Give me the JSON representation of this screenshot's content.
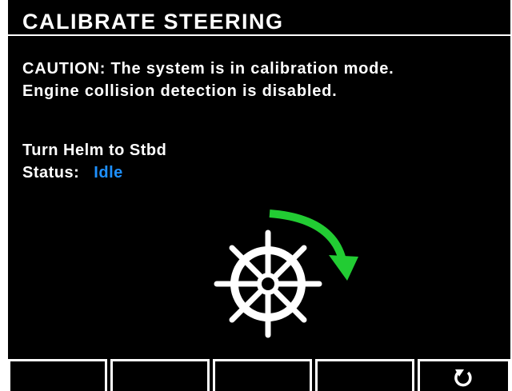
{
  "header": {
    "title": "CALIBRATE STEERING"
  },
  "caution": {
    "line1": "CAUTION: The system is in calibration mode.",
    "line2": "Engine collision detection is disabled."
  },
  "instruction": {
    "text": "Turn Helm to Stbd"
  },
  "status": {
    "label": "Status:",
    "value": "Idle",
    "value_color": "#1e90ff"
  },
  "graphic": {
    "wheel_icon": "ship-helm-wheel-icon",
    "arrow_icon": "turn-starboard-arrow-icon",
    "arrow_color": "#22cc33"
  },
  "softkeys": [
    {
      "label": "",
      "icon": null
    },
    {
      "label": "",
      "icon": null
    },
    {
      "label": "",
      "icon": null
    },
    {
      "label": "",
      "icon": null
    },
    {
      "label": "",
      "icon": "back-icon"
    }
  ],
  "colors": {
    "background": "#000000",
    "text": "#ffffff",
    "accent": "#1e90ff"
  }
}
